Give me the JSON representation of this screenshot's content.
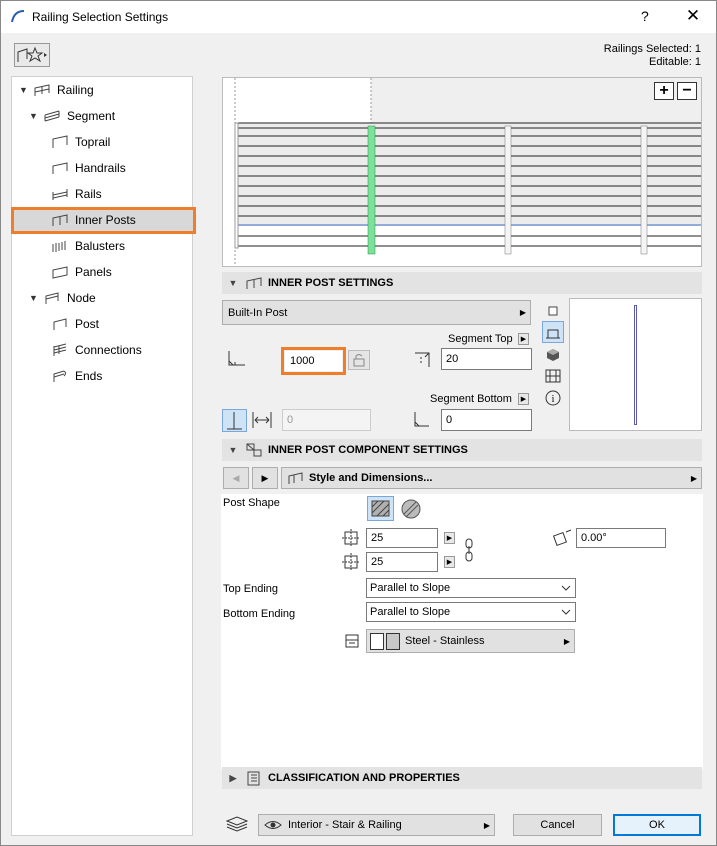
{
  "window": {
    "title": "Railing Selection Settings",
    "help": "?",
    "close": "✕"
  },
  "selection": {
    "selected": "Railings Selected: 1",
    "editable": "Editable: 1"
  },
  "tree": [
    {
      "label": "Railing"
    },
    {
      "label": "Segment"
    },
    {
      "label": "Toprail"
    },
    {
      "label": "Handrails"
    },
    {
      "label": "Rails"
    },
    {
      "label": "Inner Posts"
    },
    {
      "label": "Balusters"
    },
    {
      "label": "Panels"
    },
    {
      "label": "Node"
    },
    {
      "label": "Post"
    },
    {
      "label": "Connections"
    },
    {
      "label": "Ends"
    }
  ],
  "preview": {
    "add": "+",
    "remove": "−"
  },
  "inner_post": {
    "header": "INNER POST SETTINGS",
    "type": "Built-In Post",
    "segment_top_label": "Segment Top",
    "segment_top_value": "20",
    "distance_value": "1000",
    "segment_bottom_label": "Segment Bottom",
    "segment_bottom_value": "0",
    "disabled_value": "0"
  },
  "component": {
    "header": "INNER POST COMPONENT SETTINGS",
    "page": "Style and Dimensions...",
    "post_shape_label": "Post Shape",
    "width_value": "25",
    "depth_value": "25",
    "angle_value": "0.00°",
    "top_ending_label": "Top Ending",
    "top_ending_value": "Parallel to Slope",
    "bottom_ending_label": "Bottom Ending",
    "bottom_ending_value": "Parallel to Slope",
    "material": "Steel - Stainless"
  },
  "classification": {
    "header": "CLASSIFICATION AND PROPERTIES"
  },
  "footer": {
    "layer": "Interior - Stair & Railing",
    "cancel": "Cancel",
    "ok": "OK"
  },
  "colors": {
    "highlight": "#f07d2a",
    "selected_post": "#7be29a"
  }
}
